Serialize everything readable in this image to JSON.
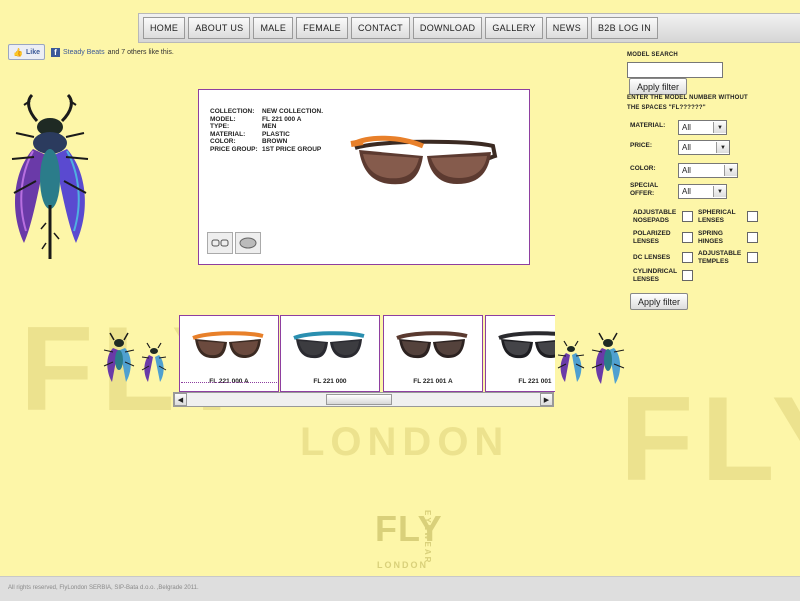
{
  "nav": {
    "items": [
      "HOME",
      "ABOUT US",
      "MALE",
      "FEMALE",
      "CONTACT",
      "DOWNLOAD",
      "GALLERY",
      "NEWS",
      "B2B LOG IN"
    ]
  },
  "social": {
    "like_label": "Like",
    "fb_letter": "f",
    "friend_name": "Steady Beats",
    "like_text": "and 7 others like this."
  },
  "product": {
    "specs": [
      {
        "key": "COLLECTION:",
        "value": "NEW COLLECTION."
      },
      {
        "key": "MODEL:",
        "value": "FL 221 000 A"
      },
      {
        "key": "TYPE:",
        "value": "MEN"
      },
      {
        "key": "MATERIAL:",
        "value": "PLASTIC"
      },
      {
        "key": "COLOR:",
        "value": "BROWN"
      },
      {
        "key": "PRICE GROUP:",
        "value": "1ST PRICE GROUP"
      }
    ]
  },
  "search": {
    "title": "MODEL SEARCH",
    "value": "",
    "button": "Apply filter",
    "hint_line1": "ENTER THE MODEL NUMBER WITHOUT",
    "hint_line2": "THE SPACES \"FL??????\""
  },
  "filters": {
    "selects": [
      {
        "label": "MATERIAL:",
        "value": "All"
      },
      {
        "label": "PRICE:",
        "value": "All"
      },
      {
        "label": "COLOR:",
        "value": "All"
      },
      {
        "label1": "SPECIAL",
        "label2": "OFFER:",
        "value": "All"
      }
    ],
    "checkboxes": [
      {
        "l1": "ADJUSTABLE",
        "l2": "NOSEPADS",
        "checked": false
      },
      {
        "l1": "SPHERICAL",
        "l2": "LENSES",
        "checked": false
      },
      {
        "l1": "POLARIZED",
        "l2": "LENSES",
        "checked": false
      },
      {
        "l1": "SPRING",
        "l2": "HINGES",
        "checked": false
      },
      {
        "l1": "DC LENSES",
        "l2": "",
        "checked": false
      },
      {
        "l1": "ADJUSTABLE",
        "l2": "TEMPLES",
        "checked": false
      },
      {
        "l1": "CYLINDRICAL",
        "l2": "LENSES",
        "checked": false
      }
    ],
    "button": "Apply filter"
  },
  "carousel": {
    "items": [
      {
        "label": "FL 221 000 A",
        "frame": "#3b2a22",
        "accent": "#e8802a",
        "lens": "#6b4a3e"
      },
      {
        "label": "FL 221 000",
        "frame": "#2a2a30",
        "accent": "#2a8fb0",
        "lens": "#3c3c40"
      },
      {
        "label": "FL 221 001 A",
        "frame": "#2c2220",
        "accent": "#5a3a30",
        "lens": "#54423c"
      },
      {
        "label": "FL 221 001",
        "frame": "#1e1e22",
        "accent": "#2a2a2e",
        "lens": "#444448"
      }
    ]
  },
  "colors": {
    "background": "#fdf6a8",
    "panel_border": "#8e3fa0",
    "facebook": "#3b5998"
  },
  "footer": {
    "text": "All rights reserved, FlyLondon SERBIA, SIP-Bata d.o.o. ,Belgrade 2011."
  },
  "watermark": {
    "brand": "FLY",
    "city": "LONDON",
    "eyewear": "EYEWEAR"
  }
}
